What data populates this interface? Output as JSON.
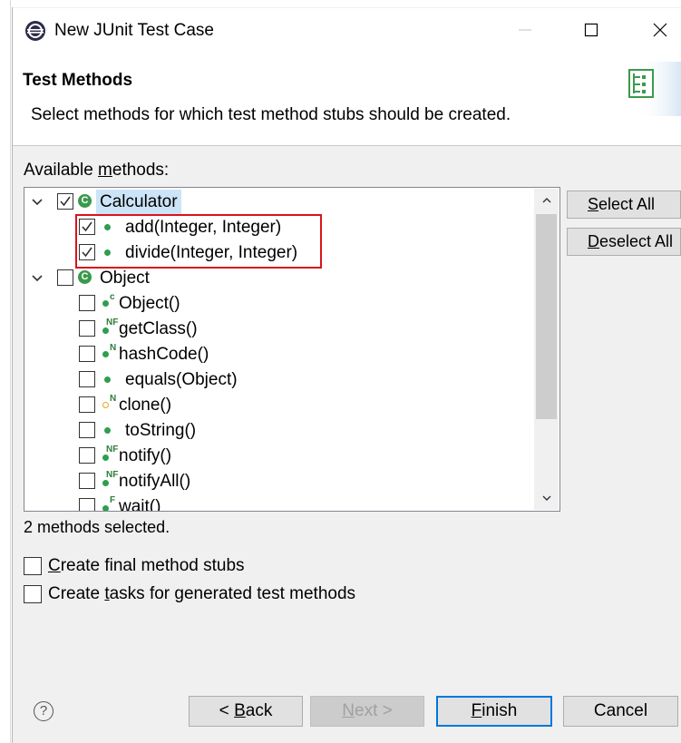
{
  "window": {
    "title": "New JUnit Test Case",
    "minimize_label": "—",
    "maximize_label": "☐",
    "close_label": "✕"
  },
  "header": {
    "title": "Test Methods",
    "description": "Select methods for which test method stubs should be created."
  },
  "methods_panel": {
    "label_prefix": "Available ",
    "label_mnemonic": "m",
    "label_suffix": "ethods:",
    "tree": [
      {
        "label": "Calculator",
        "checked": true,
        "expanded": true,
        "selected": true,
        "icon": "class-icon",
        "icon_glyph": "C"
      },
      {
        "label": "add(Integer, Integer)",
        "checked": true,
        "modifier": "",
        "icon": "public-method-icon"
      },
      {
        "label": "divide(Integer, Integer)",
        "checked": true,
        "modifier": "",
        "icon": "public-method-icon"
      },
      {
        "label": "Object",
        "checked": false,
        "expanded": true,
        "icon": "class-icon",
        "icon_glyph": "C"
      },
      {
        "label": "Object()",
        "checked": false,
        "modifier": "c",
        "icon": "constructor-icon"
      },
      {
        "label": "getClass()",
        "checked": false,
        "modifier": "NF",
        "icon": "public-method-icon"
      },
      {
        "label": "hashCode()",
        "checked": false,
        "modifier": "N",
        "icon": "public-method-icon"
      },
      {
        "label": "equals(Object)",
        "checked": false,
        "modifier": "",
        "icon": "public-method-icon"
      },
      {
        "label": "clone()",
        "checked": false,
        "modifier": "N",
        "icon": "protected-method-icon"
      },
      {
        "label": "toString()",
        "checked": false,
        "modifier": "",
        "icon": "public-method-icon"
      },
      {
        "label": "notify()",
        "checked": false,
        "modifier": "NF",
        "icon": "public-method-icon"
      },
      {
        "label": "notifyAll()",
        "checked": false,
        "modifier": "NF",
        "icon": "public-method-icon"
      },
      {
        "label": "wait()",
        "checked": false,
        "modifier": "F",
        "icon": "public-method-icon"
      }
    ],
    "select_all": {
      "mnemonic": "S",
      "rest": "elect All"
    },
    "deselect_all": {
      "mnemonic": "D",
      "rest": "eselect All"
    },
    "status": "2 methods selected."
  },
  "options": {
    "final_stubs": {
      "mnemonic": "C",
      "rest": "reate final method stubs",
      "checked": false
    },
    "create_tasks": {
      "before": "Create ",
      "mnemonic": "t",
      "rest": "asks for generated test methods",
      "checked": false
    }
  },
  "footer": {
    "help_glyph": "?",
    "back": {
      "prefix": "< ",
      "mnemonic": "B",
      "rest": "ack"
    },
    "next": {
      "mnemonic": "N",
      "rest": "ext >",
      "disabled": true
    },
    "finish": {
      "mnemonic": "F",
      "rest": "inish",
      "default": true
    },
    "cancel": "Cancel"
  },
  "colors": {
    "selection": "#cce4f7",
    "highlight_box": "#d9141b",
    "method_dot": "#2f9e4f",
    "class_icon": "#3a9a4b",
    "default_button_border": "#0078d7"
  }
}
